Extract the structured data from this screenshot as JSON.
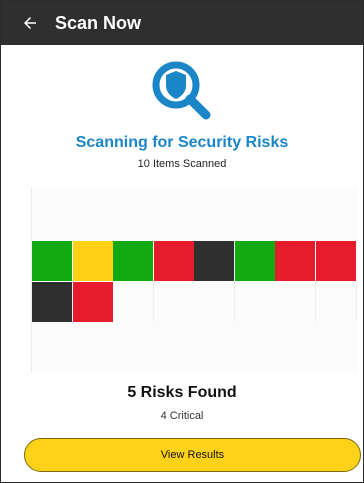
{
  "appbar": {
    "title": "Scan Now"
  },
  "scan": {
    "title": "Scanning for Security Risks",
    "items_scanned": "10 Items Scanned"
  },
  "results": {
    "title": "5 Risks Found",
    "critical": "4 Critical",
    "button_label": "View Results"
  },
  "colors": {
    "green": "#13a913",
    "yellow": "#ffd116",
    "red": "#e61b2c",
    "black": "#2f2f2f",
    "accent": "#1a86c7"
  },
  "grid_cells": [
    "green",
    "yellow",
    "green",
    "red",
    "black",
    "green",
    "red",
    "red",
    "black",
    "red"
  ]
}
